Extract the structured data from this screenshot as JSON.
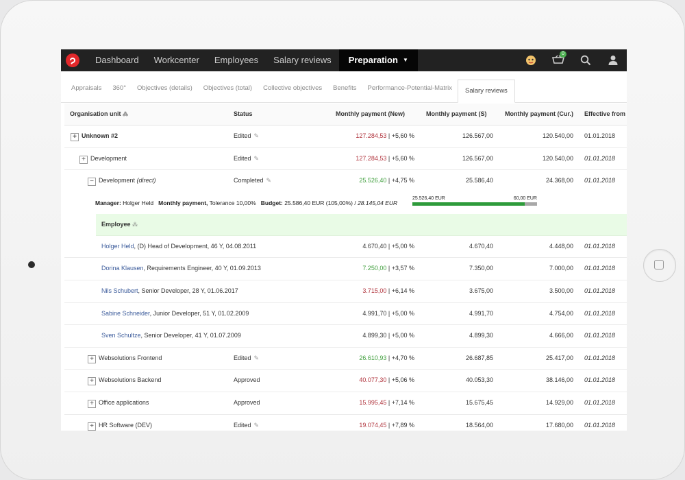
{
  "nav": {
    "items": [
      "Dashboard",
      "Workcenter",
      "Employees",
      "Salary reviews"
    ],
    "active": "Preparation",
    "cart_badge": "0",
    "icons": [
      "emoji-icon",
      "cart-icon",
      "search-icon",
      "user-icon"
    ]
  },
  "subtabs": [
    "Appraisals",
    "360°",
    "Objectives (details)",
    "Objectives (total)",
    "Collective objectives",
    "Benefits",
    "Performance-Potential-Matrix",
    "Salary reviews"
  ],
  "active_subtab": "Salary reviews",
  "columns": {
    "org": "Organisation unit",
    "status": "Status",
    "new": "Monthly payment (New)",
    "s": "Monthly payment (S)",
    "cur": "Monthly payment (Cur.)",
    "eff": "Effective from"
  },
  "rows_top": [
    {
      "name": "Unknown #2",
      "status": "Edited",
      "new": "127.284,53",
      "pct": "| +5,60 %",
      "s": "126.567,00",
      "cur": "120.540,00",
      "eff": "01.01.2018"
    },
    {
      "name": "Development",
      "status": "Edited",
      "new": "127.284,53",
      "pct": "| +5,60 %",
      "s": "126.567,00",
      "cur": "120.540,00",
      "eff": "01.01.2018"
    },
    {
      "name": "Development",
      "name_suffix": "(direct)",
      "status": "Completed",
      "new": "25.526,40",
      "pct": "| +4,75 %",
      "s": "25.586,40",
      "cur": "24.368,00",
      "eff": "01.01.2018"
    }
  ],
  "manager": {
    "label": "Manager:",
    "name": "Holger Held",
    "payment_label": "Monthly payment,",
    "tolerance": "Tolerance 10,00%",
    "budget_label": "Budget:",
    "budget": "25.586,40 EUR (105,00%) /",
    "budget_max": "28.145,04 EUR",
    "bar_left": "25.526,40 EUR",
    "bar_right": "60,00 EUR",
    "bar_fill": 0.9
  },
  "employee_header": "Employee",
  "employees": [
    {
      "name": "Holger Held",
      "desc": ", (D) Head of Development, 46 Y, 04.08.2011",
      "new": "4.670,40",
      "pct": "| +5,00 %",
      "s": "4.670,40",
      "cur": "4.448,00",
      "eff": "01.01.2018"
    },
    {
      "name": "Dorina Klausen",
      "desc": ", Requirements Engineer, 40 Y, 01.09.2013",
      "new": "7.250,00",
      "pct": "| +3,57 %",
      "s": "7.350,00",
      "cur": "7.000,00",
      "eff": "01.01.2018"
    },
    {
      "name": "Nils Schubert",
      "desc": ", Senior Developer, 28 Y, 01.06.2017",
      "new": "3.715,00",
      "pct": "| +6,14 %",
      "s": "3.675,00",
      "cur": "3.500,00",
      "eff": "01.01.2018"
    },
    {
      "name": "Sabine Schneider",
      "desc": ", Junior Developer, 51 Y, 01.02.2009",
      "new": "4.991,70",
      "pct": "| +5,00 %",
      "s": "4.991,70",
      "cur": "4.754,00",
      "eff": "01.01.2018"
    },
    {
      "name": "Sven Schultze",
      "desc": ", Senior Developer, 41 Y, 01.07.2009",
      "new": "4.899,30",
      "pct": "| +5,00 %",
      "s": "4.899,30",
      "cur": "4.666,00",
      "eff": "01.01.2018"
    }
  ],
  "rows_bottom": [
    {
      "name": "Websolutions Frontend",
      "status": "Edited",
      "new": "26.610,93",
      "pct": "| +4,70 %",
      "s": "26.687,85",
      "cur": "25.417,00",
      "eff": "01.01.2018"
    },
    {
      "name": "Websolutions Backend",
      "status": "Approved",
      "new": "40.077,30",
      "pct": "| +5,06 %",
      "s": "40.053,30",
      "cur": "38.146,00",
      "eff": "01.01.2018"
    },
    {
      "name": "Office applications",
      "status": "Approved",
      "new": "15.995,45",
      "pct": "| +7,14 %",
      "s": "15.675,45",
      "cur": "14.929,00",
      "eff": "01.01.2018"
    },
    {
      "name": "HR Software (DEV)",
      "status": "Edited",
      "new": "19.074,45",
      "pct": "| +7,89 %",
      "s": "18.564,00",
      "cur": "17.680,00",
      "eff": "01.01.2018"
    }
  ],
  "colors": {
    "red": "#b0333c",
    "green": "#3f9e3c",
    "link": "#3a5a9a",
    "nav_bg": "#222222"
  }
}
